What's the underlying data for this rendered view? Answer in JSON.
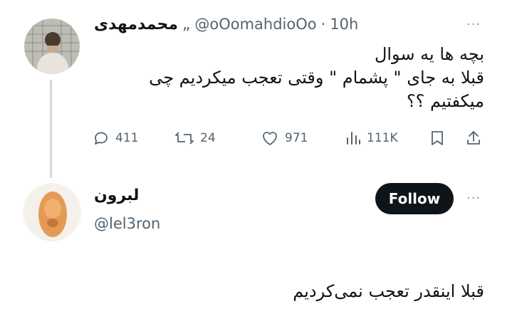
{
  "tweet": {
    "author_name": "محمدمهدی",
    "name_mark": "„",
    "handle": "@oOomahdioOo",
    "separator": "·",
    "time": "10h",
    "more": "···",
    "text_lines": [
      "بچه ها یه سوال",
      "قبلا به جای \" پشمام \" وقتی تعجب میکردیم چی",
      "میکفتیم ؟؟"
    ],
    "actions": {
      "replies": "411",
      "retweets": "24",
      "likes": "971",
      "views": "111K"
    }
  },
  "reply": {
    "author_name": "لبرون",
    "handle": "@lel3ron",
    "follow_label": "Follow",
    "more": "···",
    "text": "قبلا اینقدر تعجب نمی‌کردیم"
  },
  "icons": [
    "avatar",
    "reply-icon",
    "retweet-icon",
    "like-icon",
    "views-icon",
    "bookmark-icon",
    "share-icon",
    "more-icon"
  ],
  "colors": {
    "text": "#0f1419",
    "muted": "#536471",
    "button": "#0f1419",
    "line": "#cfd9de"
  }
}
